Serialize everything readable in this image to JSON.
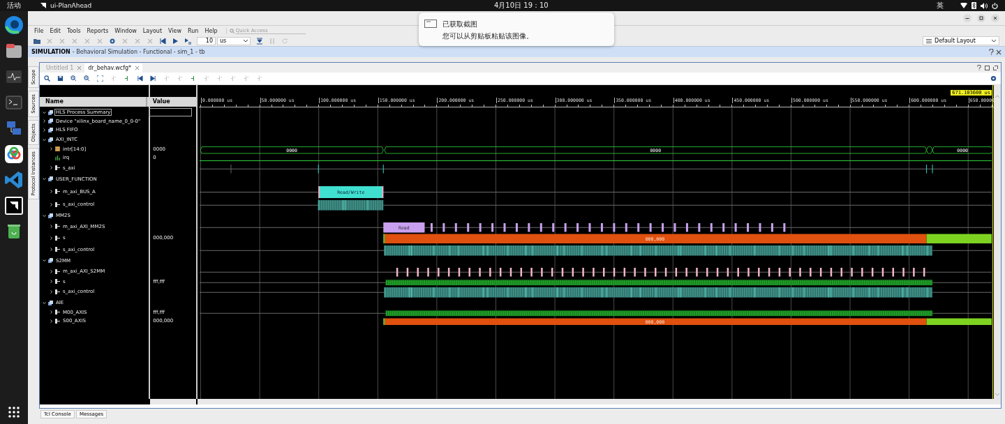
{
  "top_bar": {
    "activities": "活动",
    "app": "ui-PlanAhead",
    "clock": "4月10日 19：10",
    "input_method": "英"
  },
  "notification": {
    "title": "已获取截图",
    "body": "您可以从剪贴板粘贴该图像。"
  },
  "menu": [
    "File",
    "Edit",
    "Tools",
    "Reports",
    "Window",
    "Layout",
    "View",
    "Run",
    "Help"
  ],
  "quick_access": {
    "placeholder": "Quick Access"
  },
  "run_time": {
    "value": "10",
    "unit": "us"
  },
  "layout_select": "Default Layout",
  "simulation_bar": {
    "title": "SIMULATION",
    "subtitle": "- Behavioral Simulation - Functional - sim_1 - tb"
  },
  "side_tabs": [
    "Scope",
    "Sources",
    "Objects",
    "Protocol Instances"
  ],
  "tabs": [
    {
      "label": "Untitled 1",
      "selected": false
    },
    {
      "label": "dr_behav.wcfg*",
      "selected": true
    }
  ],
  "columns": [
    "Name",
    "Value"
  ],
  "cursor": "671.103600 us",
  "time_ticks": [
    "0.000000 us",
    "50.000000 us",
    "100.000000 us",
    "150.000000 us",
    "200.000000 us",
    "250.000000 us",
    "300.000000 us",
    "350.000000 us",
    "400.000000 us",
    "450.000000 us",
    "500.000000 us",
    "550.000000 us",
    "600.000000 us",
    "650.00000"
  ],
  "signals": [
    {
      "name": "HLS Process Summary",
      "kind": "group",
      "expanded": true,
      "selected": true
    },
    {
      "name": "Device \"xilinx_board_name_0_0-0\"",
      "kind": "group",
      "expanded": false,
      "selected": false
    },
    {
      "name": "HLS FIFO",
      "kind": "group",
      "expanded": false,
      "selected": false
    },
    {
      "name": "AXI_INTC",
      "kind": "group",
      "expanded": true,
      "selected": false,
      "children": [
        {
          "name": "intr[14:0]",
          "kind": "bus",
          "value": "0000",
          "wave": {
            "kind": "bus",
            "labels": [
              "0000",
              "0000",
              "0000"
            ]
          }
        },
        {
          "name": "irq",
          "kind": "bit",
          "value": "0",
          "wave": {
            "kind": "low"
          }
        },
        {
          "name": "s_axi",
          "kind": "interface",
          "wave": {
            "kind": "pulses"
          }
        }
      ]
    },
    {
      "name": "USER_FUNCTION",
      "kind": "group",
      "expanded": true,
      "selected": false,
      "children": [
        {
          "name": "m_axi_BUS_A",
          "kind": "interface",
          "wave": {
            "kind": "transaction",
            "labels": [
              "Read/Write"
            ]
          }
        },
        {
          "name": "s_axi_control",
          "kind": "interface",
          "wave": {
            "kind": "activity"
          }
        }
      ]
    },
    {
      "name": "MM2S",
      "kind": "group",
      "expanded": true,
      "selected": false,
      "children": [
        {
          "name": "m_axi_AXI_MM2S",
          "kind": "interface",
          "wave": {
            "kind": "read_burst",
            "labels": [
              "Read"
            ]
          }
        },
        {
          "name": "s",
          "kind": "interface",
          "value": "000,000",
          "wave": {
            "kind": "bus_fill",
            "labels": [
              "000,000"
            ]
          }
        },
        {
          "name": "s_axi_control",
          "kind": "interface",
          "wave": {
            "kind": "activity"
          }
        }
      ]
    },
    {
      "name": "S2MM",
      "kind": "group",
      "expanded": true,
      "selected": false,
      "children": [
        {
          "name": "m_axi_AXI_S2MM",
          "kind": "interface",
          "wave": {
            "kind": "write_ticks"
          }
        },
        {
          "name": "s",
          "kind": "interface",
          "value": "fff,fff",
          "wave": {
            "kind": "stream"
          }
        },
        {
          "name": "s_axi_control",
          "kind": "interface",
          "wave": {
            "kind": "activity"
          }
        }
      ]
    },
    {
      "name": "AIE",
      "kind": "group",
      "expanded": true,
      "selected": false,
      "children": [
        {
          "name": "M00_AXIS",
          "kind": "interface",
          "value": "fff,fff",
          "wave": {
            "kind": "stream"
          }
        },
        {
          "name": "S00_AXIS",
          "kind": "interface",
          "value": "000,000",
          "wave": {
            "kind": "bus_fill",
            "labels": [
              "000,000"
            ]
          }
        }
      ]
    }
  ],
  "bottom_tabs": [
    "Tcl Console",
    "Messages"
  ]
}
